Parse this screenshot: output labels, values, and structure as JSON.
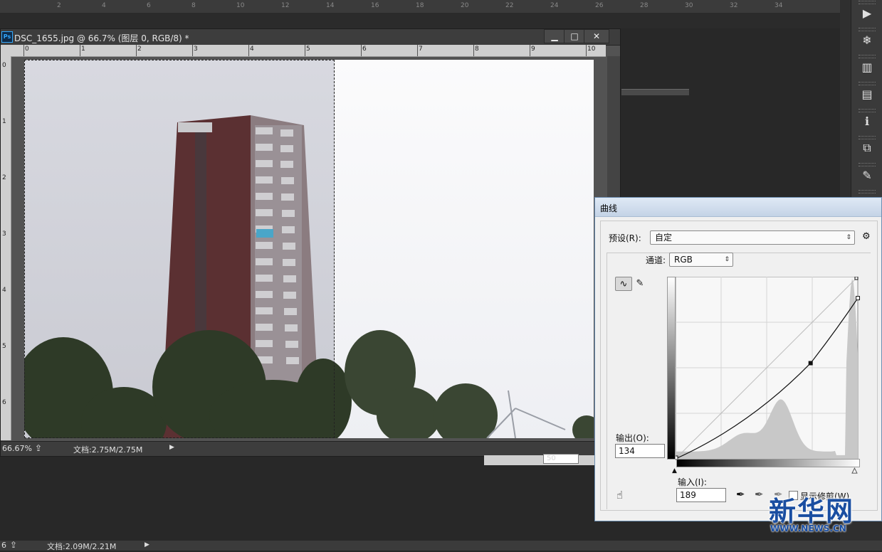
{
  "top_ruler": {
    "labels": [
      "2",
      "4",
      "6",
      "8",
      "10",
      "12",
      "14",
      "16",
      "18",
      "20",
      "22",
      "24",
      "26",
      "28",
      "30",
      "32",
      "34"
    ]
  },
  "right_dock": {
    "icons": [
      "play-icon",
      "snowflake-icon",
      "histogram-icon",
      "swatch-icon",
      "info-icon",
      "layers-icon",
      "brush-icon",
      "adjust-icon"
    ],
    "glyphs": [
      "▶",
      "❄",
      "▥",
      "▤",
      "ℹ",
      "⧉",
      "✎",
      "☰"
    ]
  },
  "document": {
    "ps_badge": "Ps",
    "title": "DSC_1655.jpg @ 66.7% (图层 0, RGB/8) *",
    "buttons": {
      "minimize": "▁",
      "restore": "□",
      "close": "✕"
    },
    "h_ruler_labels": [
      "0",
      "1",
      "2",
      "3",
      "4",
      "5",
      "6",
      "7",
      "8",
      "9",
      "10"
    ],
    "v_ruler_labels": [
      "0",
      "1",
      "2",
      "3",
      "4",
      "5",
      "6"
    ],
    "status": {
      "zoom": "66.67%",
      "doc_size": "文档:2.75M/2.75M",
      "menu_arrow": "▶"
    }
  },
  "second_doc_status": {
    "zoom": "6",
    "doc_size": "文档:2.09M/2.21M",
    "menu_arrow": "▶"
  },
  "mid_strip": {
    "value": "50"
  },
  "curves": {
    "title": "曲线",
    "preset_label": "预设(R):",
    "preset_value": "自定",
    "channel_label": "通道:",
    "channel_value": "RGB",
    "output_label": "输出(O):",
    "output_value": "134",
    "input_label": "输入(I):",
    "input_value": "189",
    "show_clipping_label": "显示修剪(W)",
    "point": {
      "input": 189,
      "output": 134
    },
    "colors": {
      "curve": "#111111",
      "histogram": "#c8c8c8",
      "grid": "#cfcfcf"
    }
  },
  "watermark": {
    "text": "新华网",
    "url": "WWW.NEWS.CN",
    "color": "#1a4ea1"
  }
}
